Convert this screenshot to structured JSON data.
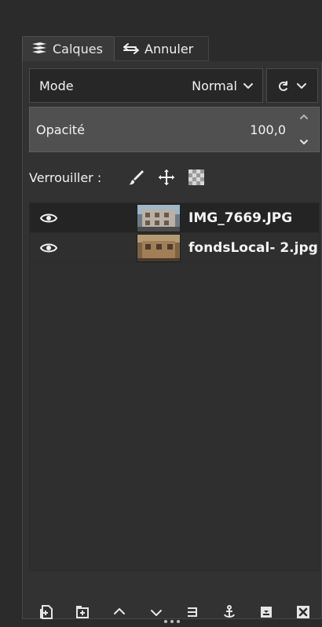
{
  "tabs": [
    {
      "label": "Calques",
      "icon": "layers-icon"
    },
    {
      "label": "Annuler",
      "icon": "undo-icon"
    }
  ],
  "dock_menu_icon": "dock-menu-icon",
  "mode": {
    "label": "Mode",
    "value": "Normal",
    "icon": "chevron-down-icon",
    "secondary_icon": "composite-mode-icon"
  },
  "opacity": {
    "label": "Opacité",
    "value": "100,0"
  },
  "lock": {
    "label": "Verrouiller :",
    "icons": [
      "paintbrush-icon",
      "move-icon",
      "alpha-checker-icon"
    ]
  },
  "layers": [
    {
      "name": "IMG_7669.JPG",
      "visible": true
    },
    {
      "name": "fondsLocal- 2.jpg",
      "visible": true
    }
  ],
  "bottom_tools": [
    "new-layer-icon",
    "new-layer-group-icon",
    "raise-layer-icon",
    "lower-layer-icon",
    "duplicate-layer-icon",
    "anchor-layer-icon",
    "merge-down-icon",
    "delete-layer-icon"
  ]
}
